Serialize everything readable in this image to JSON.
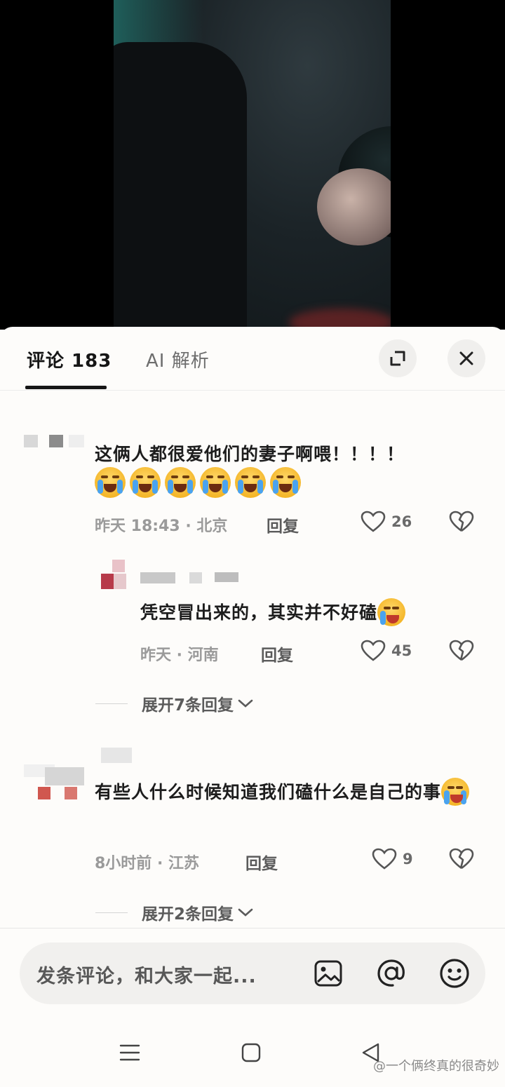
{
  "tabs": {
    "comments_label": "评论 183",
    "ai_label": "AI 解析"
  },
  "comments": [
    {
      "text": "这俩人都很爱他们的妻子啊喂！！！！",
      "emoji_count": 6,
      "time_location": "昨天 18:43 · 北京",
      "reply_label": "回复",
      "likes": "26",
      "replies": [
        {
          "text": "凭空冒出来的，其实并不好磕",
          "time_location": "昨天 · 河南",
          "reply_label": "回复",
          "likes": "45"
        }
      ],
      "expand_label": "展开7条回复"
    },
    {
      "text": "有些人什么时候知道我们磕什么是自己的事",
      "time_location": "8小时前 · 江苏",
      "reply_label": "回复",
      "likes": "9",
      "expand_label": "展开2条回复"
    }
  ],
  "input": {
    "placeholder": "发条评论，和大家一起..."
  },
  "watermark": "@一个俩终真的很奇妙",
  "icons": [
    "expand-icon",
    "close-icon",
    "heart-icon",
    "broken-heart-icon",
    "image-icon",
    "at-icon",
    "emoji-icon",
    "menu-icon",
    "home-icon",
    "back-icon"
  ],
  "colors": {
    "background": "#fdfcfa",
    "text": "#1d1d1d",
    "muted": "#9a9a9a"
  }
}
